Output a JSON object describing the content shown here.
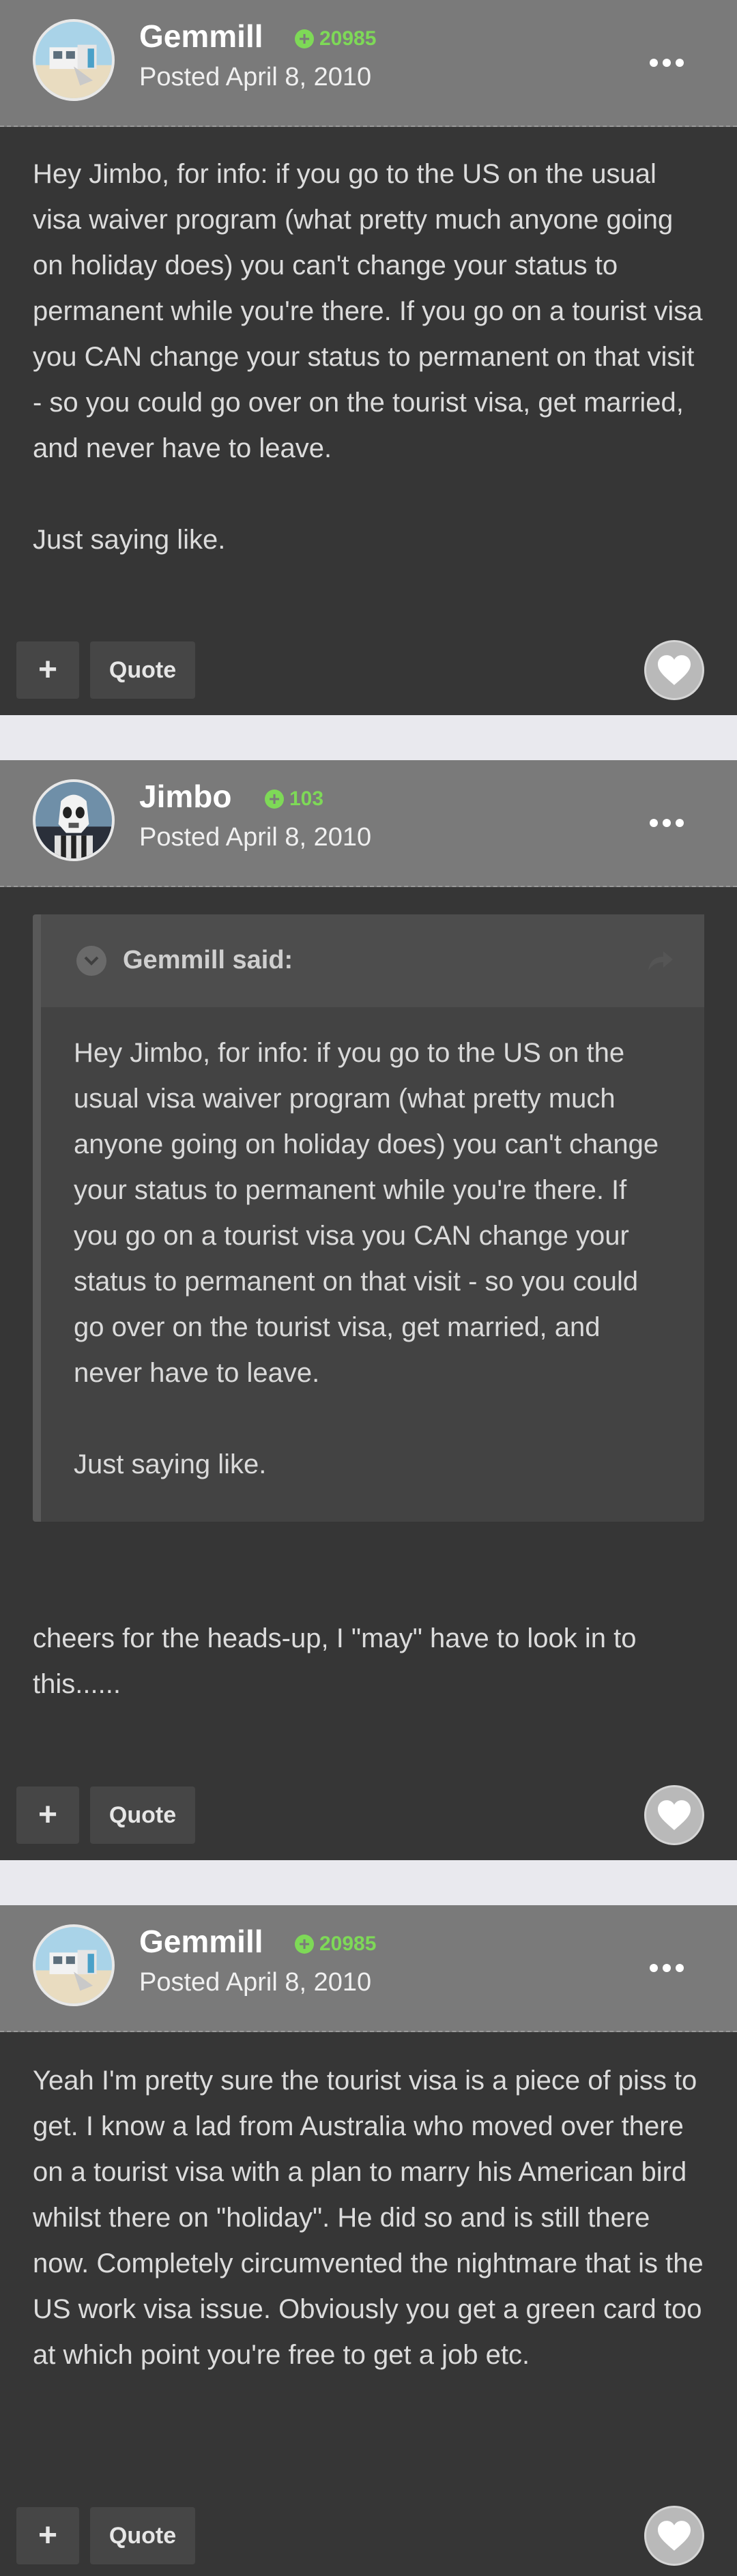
{
  "colors": {
    "page_bg": "#e9e9ee",
    "post_bg": "#363636",
    "header_bg": "#7a7a7a",
    "reputation": "#7ed957",
    "quote_bg": "#434343"
  },
  "posts": [
    {
      "author": "Gemmill",
      "reputation": "20985",
      "posted": "Posted April 8, 2010",
      "body": [
        "Hey Jimbo, for info: if you go to the US on the usual visa waiver program (what pretty much anyone going on holiday does) you can't change your status to permanent while you're there. If you go on a tourist visa you CAN change your status to permanent on that visit - so you could go over on the tourist visa, get married, and never have to leave.",
        "Just saying like."
      ],
      "plus_label": "+",
      "quote_label": "Quote",
      "avatar_icon": "beach-house-avatar-icon"
    },
    {
      "author": "Jimbo",
      "reputation": "103",
      "posted": "Posted April 8, 2010",
      "quote": {
        "header": "Gemmill said:",
        "body": [
          "Hey Jimbo, for info: if you go to the US on the usual visa waiver program (what pretty much anyone going on holiday does) you can't change your status to permanent while you're there. If you go on a tourist visa you CAN change your status to permanent on that visit - so you could go over on the tourist visa, get married, and never have to leave.",
          "Just saying like."
        ]
      },
      "body": [
        "cheers for the heads-up, I \"may\" have to look in to this......"
      ],
      "plus_label": "+",
      "quote_label": "Quote",
      "avatar_icon": "stormtrooper-avatar-icon"
    },
    {
      "author": "Gemmill",
      "reputation": "20985",
      "posted": "Posted April 8, 2010",
      "body": [
        "Yeah I'm pretty sure the tourist visa is a piece of piss to get. I know a lad from Australia who moved over there on a tourist visa with a plan to marry his American bird whilst there on \"holiday\". He did so and is still there now. Completely circumvented the nightmare that is the US work visa issue. Obviously you get a green card too at which point you're free to get a job etc."
      ],
      "plus_label": "+",
      "quote_label": "Quote",
      "avatar_icon": "beach-house-avatar-icon"
    }
  ]
}
